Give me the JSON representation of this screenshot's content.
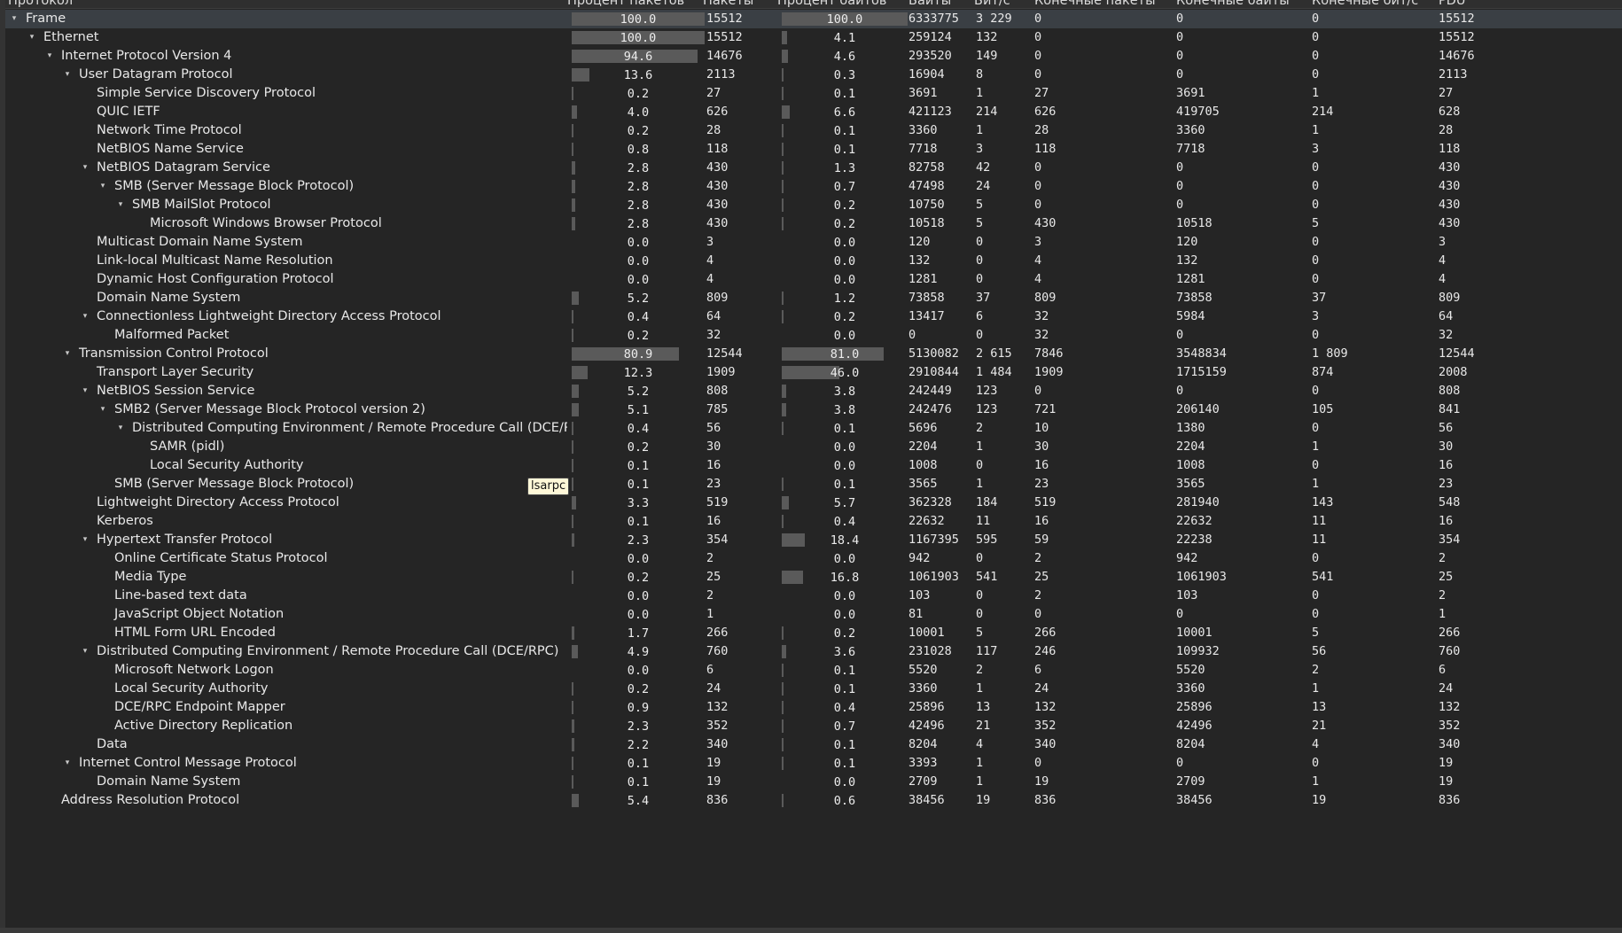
{
  "columns": [
    "Протокол",
    "Процент пакетов",
    "Пакеты",
    "Процент байтов",
    "Байты",
    "Бит/с",
    "Конечные пакеты",
    "Конечные байты",
    "Конечные бит/с",
    "PDU"
  ],
  "tooltip": "lsarpc",
  "rows": [
    {
      "name": "Frame",
      "level": 0,
      "toggle": "▾",
      "pkt_pct": "100.0",
      "packets": "15512",
      "byte_pct": "100.0",
      "bytes": "6333775",
      "bps": "3 229",
      "end_packets": "0",
      "end_bytes": "0",
      "end_bps": "0",
      "pdu": "15512",
      "pkt_pct_value": 100.0,
      "byte_pct_value": 100.0
    },
    {
      "name": "Ethernet",
      "level": 1,
      "toggle": "▾",
      "pkt_pct": "100.0",
      "packets": "15512",
      "byte_pct": "4.1",
      "bytes": "259124",
      "bps": "132",
      "end_packets": "0",
      "end_bytes": "0",
      "end_bps": "0",
      "pdu": "15512",
      "pkt_pct_value": 100.0,
      "byte_pct_value": 4.1
    },
    {
      "name": "Internet Protocol Version 4",
      "level": 2,
      "toggle": "▾",
      "pkt_pct": "94.6",
      "packets": "14676",
      "byte_pct": "4.6",
      "bytes": "293520",
      "bps": "149",
      "end_packets": "0",
      "end_bytes": "0",
      "end_bps": "0",
      "pdu": "14676",
      "pkt_pct_value": 94.6,
      "byte_pct_value": 4.6
    },
    {
      "name": "User Datagram Protocol",
      "level": 3,
      "toggle": "▾",
      "pkt_pct": "13.6",
      "packets": "2113",
      "byte_pct": "0.3",
      "bytes": "16904",
      "bps": "8",
      "end_packets": "0",
      "end_bytes": "0",
      "end_bps": "0",
      "pdu": "2113",
      "pkt_pct_value": 13.6,
      "byte_pct_value": 0.3
    },
    {
      "name": "Simple Service Discovery Protocol",
      "level": 4,
      "toggle": "",
      "pkt_pct": "0.2",
      "packets": "27",
      "byte_pct": "0.1",
      "bytes": "3691",
      "bps": "1",
      "end_packets": "27",
      "end_bytes": "3691",
      "end_bps": "1",
      "pdu": "27",
      "pkt_pct_value": 0.2,
      "byte_pct_value": 0.1
    },
    {
      "name": "QUIC IETF",
      "level": 4,
      "toggle": "",
      "pkt_pct": "4.0",
      "packets": "626",
      "byte_pct": "6.6",
      "bytes": "421123",
      "bps": "214",
      "end_packets": "626",
      "end_bytes": "419705",
      "end_bps": "214",
      "pdu": "628",
      "pkt_pct_value": 4.0,
      "byte_pct_value": 6.6
    },
    {
      "name": "Network Time Protocol",
      "level": 4,
      "toggle": "",
      "pkt_pct": "0.2",
      "packets": "28",
      "byte_pct": "0.1",
      "bytes": "3360",
      "bps": "1",
      "end_packets": "28",
      "end_bytes": "3360",
      "end_bps": "1",
      "pdu": "28",
      "pkt_pct_value": 0.2,
      "byte_pct_value": 0.1
    },
    {
      "name": "NetBIOS Name Service",
      "level": 4,
      "toggle": "",
      "pkt_pct": "0.8",
      "packets": "118",
      "byte_pct": "0.1",
      "bytes": "7718",
      "bps": "3",
      "end_packets": "118",
      "end_bytes": "7718",
      "end_bps": "3",
      "pdu": "118",
      "pkt_pct_value": 0.8,
      "byte_pct_value": 0.1
    },
    {
      "name": "NetBIOS Datagram Service",
      "level": 4,
      "toggle": "▾",
      "pkt_pct": "2.8",
      "packets": "430",
      "byte_pct": "1.3",
      "bytes": "82758",
      "bps": "42",
      "end_packets": "0",
      "end_bytes": "0",
      "end_bps": "0",
      "pdu": "430",
      "pkt_pct_value": 2.8,
      "byte_pct_value": 1.3
    },
    {
      "name": "SMB (Server Message Block Protocol)",
      "level": 5,
      "toggle": "▾",
      "pkt_pct": "2.8",
      "packets": "430",
      "byte_pct": "0.7",
      "bytes": "47498",
      "bps": "24",
      "end_packets": "0",
      "end_bytes": "0",
      "end_bps": "0",
      "pdu": "430",
      "pkt_pct_value": 2.8,
      "byte_pct_value": 0.7
    },
    {
      "name": "SMB MailSlot Protocol",
      "level": 6,
      "toggle": "▾",
      "pkt_pct": "2.8",
      "packets": "430",
      "byte_pct": "0.2",
      "bytes": "10750",
      "bps": "5",
      "end_packets": "0",
      "end_bytes": "0",
      "end_bps": "0",
      "pdu": "430",
      "pkt_pct_value": 2.8,
      "byte_pct_value": 0.2
    },
    {
      "name": "Microsoft Windows Browser Protocol",
      "level": 7,
      "toggle": "",
      "pkt_pct": "2.8",
      "packets": "430",
      "byte_pct": "0.2",
      "bytes": "10518",
      "bps": "5",
      "end_packets": "430",
      "end_bytes": "10518",
      "end_bps": "5",
      "pdu": "430",
      "pkt_pct_value": 2.8,
      "byte_pct_value": 0.2
    },
    {
      "name": "Multicast Domain Name System",
      "level": 4,
      "toggle": "",
      "pkt_pct": "0.0",
      "packets": "3",
      "byte_pct": "0.0",
      "bytes": "120",
      "bps": "0",
      "end_packets": "3",
      "end_bytes": "120",
      "end_bps": "0",
      "pdu": "3",
      "pkt_pct_value": 0.0,
      "byte_pct_value": 0.0
    },
    {
      "name": "Link-local Multicast Name Resolution",
      "level": 4,
      "toggle": "",
      "pkt_pct": "0.0",
      "packets": "4",
      "byte_pct": "0.0",
      "bytes": "132",
      "bps": "0",
      "end_packets": "4",
      "end_bytes": "132",
      "end_bps": "0",
      "pdu": "4",
      "pkt_pct_value": 0.0,
      "byte_pct_value": 0.0
    },
    {
      "name": "Dynamic Host Configuration Protocol",
      "level": 4,
      "toggle": "",
      "pkt_pct": "0.0",
      "packets": "4",
      "byte_pct": "0.0",
      "bytes": "1281",
      "bps": "0",
      "end_packets": "4",
      "end_bytes": "1281",
      "end_bps": "0",
      "pdu": "4",
      "pkt_pct_value": 0.0,
      "byte_pct_value": 0.0
    },
    {
      "name": "Domain Name System",
      "level": 4,
      "toggle": "",
      "pkt_pct": "5.2",
      "packets": "809",
      "byte_pct": "1.2",
      "bytes": "73858",
      "bps": "37",
      "end_packets": "809",
      "end_bytes": "73858",
      "end_bps": "37",
      "pdu": "809",
      "pkt_pct_value": 5.2,
      "byte_pct_value": 1.2
    },
    {
      "name": "Connectionless Lightweight Directory Access Protocol",
      "level": 4,
      "toggle": "▾",
      "pkt_pct": "0.4",
      "packets": "64",
      "byte_pct": "0.2",
      "bytes": "13417",
      "bps": "6",
      "end_packets": "32",
      "end_bytes": "5984",
      "end_bps": "3",
      "pdu": "64",
      "pkt_pct_value": 0.4,
      "byte_pct_value": 0.2
    },
    {
      "name": "Malformed Packet",
      "level": 5,
      "toggle": "",
      "pkt_pct": "0.2",
      "packets": "32",
      "byte_pct": "0.0",
      "bytes": "0",
      "bps": "0",
      "end_packets": "32",
      "end_bytes": "0",
      "end_bps": "0",
      "pdu": "32",
      "pkt_pct_value": 0.2,
      "byte_pct_value": 0.0
    },
    {
      "name": "Transmission Control Protocol",
      "level": 3,
      "toggle": "▾",
      "pkt_pct": "80.9",
      "packets": "12544",
      "byte_pct": "81.0",
      "bytes": "5130082",
      "bps": "2 615",
      "end_packets": "7846",
      "end_bytes": "3548834",
      "end_bps": "1 809",
      "pdu": "12544",
      "pkt_pct_value": 80.9,
      "byte_pct_value": 81.0
    },
    {
      "name": "Transport Layer Security",
      "level": 4,
      "toggle": "",
      "pkt_pct": "12.3",
      "packets": "1909",
      "byte_pct": "46.0",
      "bytes": "2910844",
      "bps": "1 484",
      "end_packets": "1909",
      "end_bytes": "1715159",
      "end_bps": "874",
      "pdu": "2008",
      "pkt_pct_value": 12.3,
      "byte_pct_value": 46.0
    },
    {
      "name": "NetBIOS Session Service",
      "level": 4,
      "toggle": "▾",
      "pkt_pct": "5.2",
      "packets": "808",
      "byte_pct": "3.8",
      "bytes": "242449",
      "bps": "123",
      "end_packets": "0",
      "end_bytes": "0",
      "end_bps": "0",
      "pdu": "808",
      "pkt_pct_value": 5.2,
      "byte_pct_value": 3.8
    },
    {
      "name": "SMB2 (Server Message Block Protocol version 2)",
      "level": 5,
      "toggle": "▾",
      "pkt_pct": "5.1",
      "packets": "785",
      "byte_pct": "3.8",
      "bytes": "242476",
      "bps": "123",
      "end_packets": "721",
      "end_bytes": "206140",
      "end_bps": "105",
      "pdu": "841",
      "pkt_pct_value": 5.1,
      "byte_pct_value": 3.8
    },
    {
      "name": "Distributed Computing Environment / Remote Procedure Call (DCE/RPC)",
      "level": 6,
      "toggle": "▾",
      "pkt_pct": "0.4",
      "packets": "56",
      "byte_pct": "0.1",
      "bytes": "5696",
      "bps": "2",
      "end_packets": "10",
      "end_bytes": "1380",
      "end_bps": "0",
      "pdu": "56",
      "pkt_pct_value": 0.4,
      "byte_pct_value": 0.1
    },
    {
      "name": "SAMR (pidl)",
      "level": 7,
      "toggle": "",
      "pkt_pct": "0.2",
      "packets": "30",
      "byte_pct": "0.0",
      "bytes": "2204",
      "bps": "1",
      "end_packets": "30",
      "end_bytes": "2204",
      "end_bps": "1",
      "pdu": "30",
      "pkt_pct_value": 0.2,
      "byte_pct_value": 0.0
    },
    {
      "name": "Local Security Authority",
      "level": 7,
      "toggle": "",
      "pkt_pct": "0.1",
      "packets": "16",
      "byte_pct": "0.0",
      "bytes": "1008",
      "bps": "0",
      "end_packets": "16",
      "end_bytes": "1008",
      "end_bps": "0",
      "pdu": "16",
      "pkt_pct_value": 0.1,
      "byte_pct_value": 0.0
    },
    {
      "name": "SMB (Server Message Block Protocol)",
      "level": 5,
      "toggle": "",
      "pkt_pct": "0.1",
      "packets": "23",
      "byte_pct": "0.1",
      "bytes": "3565",
      "bps": "1",
      "end_packets": "23",
      "end_bytes": "3565",
      "end_bps": "1",
      "pdu": "23",
      "pkt_pct_value": 0.1,
      "byte_pct_value": 0.1
    },
    {
      "name": "Lightweight Directory Access Protocol",
      "level": 4,
      "toggle": "",
      "pkt_pct": "3.3",
      "packets": "519",
      "byte_pct": "5.7",
      "bytes": "362328",
      "bps": "184",
      "end_packets": "519",
      "end_bytes": "281940",
      "end_bps": "143",
      "pdu": "548",
      "pkt_pct_value": 3.3,
      "byte_pct_value": 5.7
    },
    {
      "name": "Kerberos",
      "level": 4,
      "toggle": "",
      "pkt_pct": "0.1",
      "packets": "16",
      "byte_pct": "0.4",
      "bytes": "22632",
      "bps": "11",
      "end_packets": "16",
      "end_bytes": "22632",
      "end_bps": "11",
      "pdu": "16",
      "pkt_pct_value": 0.1,
      "byte_pct_value": 0.4
    },
    {
      "name": "Hypertext Transfer Protocol",
      "level": 4,
      "toggle": "▾",
      "pkt_pct": "2.3",
      "packets": "354",
      "byte_pct": "18.4",
      "bytes": "1167395",
      "bps": "595",
      "end_packets": "59",
      "end_bytes": "22238",
      "end_bps": "11",
      "pdu": "354",
      "pkt_pct_value": 2.3,
      "byte_pct_value": 18.4
    },
    {
      "name": "Online Certificate Status Protocol",
      "level": 5,
      "toggle": "",
      "pkt_pct": "0.0",
      "packets": "2",
      "byte_pct": "0.0",
      "bytes": "942",
      "bps": "0",
      "end_packets": "2",
      "end_bytes": "942",
      "end_bps": "0",
      "pdu": "2",
      "pkt_pct_value": 0.0,
      "byte_pct_value": 0.0
    },
    {
      "name": "Media Type",
      "level": 5,
      "toggle": "",
      "pkt_pct": "0.2",
      "packets": "25",
      "byte_pct": "16.8",
      "bytes": "1061903",
      "bps": "541",
      "end_packets": "25",
      "end_bytes": "1061903",
      "end_bps": "541",
      "pdu": "25",
      "pkt_pct_value": 0.2,
      "byte_pct_value": 16.8
    },
    {
      "name": "Line-based text data",
      "level": 5,
      "toggle": "",
      "pkt_pct": "0.0",
      "packets": "2",
      "byte_pct": "0.0",
      "bytes": "103",
      "bps": "0",
      "end_packets": "2",
      "end_bytes": "103",
      "end_bps": "0",
      "pdu": "2",
      "pkt_pct_value": 0.0,
      "byte_pct_value": 0.0
    },
    {
      "name": "JavaScript Object Notation",
      "level": 5,
      "toggle": "",
      "pkt_pct": "0.0",
      "packets": "1",
      "byte_pct": "0.0",
      "bytes": "81",
      "bps": "0",
      "end_packets": "0",
      "end_bytes": "0",
      "end_bps": "0",
      "pdu": "1",
      "pkt_pct_value": 0.0,
      "byte_pct_value": 0.0
    },
    {
      "name": "HTML Form URL Encoded",
      "level": 5,
      "toggle": "",
      "pkt_pct": "1.7",
      "packets": "266",
      "byte_pct": "0.2",
      "bytes": "10001",
      "bps": "5",
      "end_packets": "266",
      "end_bytes": "10001",
      "end_bps": "5",
      "pdu": "266",
      "pkt_pct_value": 1.7,
      "byte_pct_value": 0.2
    },
    {
      "name": "Distributed Computing Environment / Remote Procedure Call (DCE/RPC)",
      "level": 4,
      "toggle": "▾",
      "pkt_pct": "4.9",
      "packets": "760",
      "byte_pct": "3.6",
      "bytes": "231028",
      "bps": "117",
      "end_packets": "246",
      "end_bytes": "109932",
      "end_bps": "56",
      "pdu": "760",
      "pkt_pct_value": 4.9,
      "byte_pct_value": 3.6
    },
    {
      "name": "Microsoft Network Logon",
      "level": 5,
      "toggle": "",
      "pkt_pct": "0.0",
      "packets": "6",
      "byte_pct": "0.1",
      "bytes": "5520",
      "bps": "2",
      "end_packets": "6",
      "end_bytes": "5520",
      "end_bps": "2",
      "pdu": "6",
      "pkt_pct_value": 0.0,
      "byte_pct_value": 0.1
    },
    {
      "name": "Local Security Authority",
      "level": 5,
      "toggle": "",
      "pkt_pct": "0.2",
      "packets": "24",
      "byte_pct": "0.1",
      "bytes": "3360",
      "bps": "1",
      "end_packets": "24",
      "end_bytes": "3360",
      "end_bps": "1",
      "pdu": "24",
      "pkt_pct_value": 0.2,
      "byte_pct_value": 0.1
    },
    {
      "name": "DCE/RPC Endpoint Mapper",
      "level": 5,
      "toggle": "",
      "pkt_pct": "0.9",
      "packets": "132",
      "byte_pct": "0.4",
      "bytes": "25896",
      "bps": "13",
      "end_packets": "132",
      "end_bytes": "25896",
      "end_bps": "13",
      "pdu": "132",
      "pkt_pct_value": 0.9,
      "byte_pct_value": 0.4
    },
    {
      "name": "Active Directory Replication",
      "level": 5,
      "toggle": "",
      "pkt_pct": "2.3",
      "packets": "352",
      "byte_pct": "0.7",
      "bytes": "42496",
      "bps": "21",
      "end_packets": "352",
      "end_bytes": "42496",
      "end_bps": "21",
      "pdu": "352",
      "pkt_pct_value": 2.3,
      "byte_pct_value": 0.7
    },
    {
      "name": "Data",
      "level": 4,
      "toggle": "",
      "pkt_pct": "2.2",
      "packets": "340",
      "byte_pct": "0.1",
      "bytes": "8204",
      "bps": "4",
      "end_packets": "340",
      "end_bytes": "8204",
      "end_bps": "4",
      "pdu": "340",
      "pkt_pct_value": 2.2,
      "byte_pct_value": 0.1
    },
    {
      "name": "Internet Control Message Protocol",
      "level": 3,
      "toggle": "▾",
      "pkt_pct": "0.1",
      "packets": "19",
      "byte_pct": "0.1",
      "bytes": "3393",
      "bps": "1",
      "end_packets": "0",
      "end_bytes": "0",
      "end_bps": "0",
      "pdu": "19",
      "pkt_pct_value": 0.1,
      "byte_pct_value": 0.1
    },
    {
      "name": "Domain Name System",
      "level": 4,
      "toggle": "",
      "pkt_pct": "0.1",
      "packets": "19",
      "byte_pct": "0.0",
      "bytes": "2709",
      "bps": "1",
      "end_packets": "19",
      "end_bytes": "2709",
      "end_bps": "1",
      "pdu": "19",
      "pkt_pct_value": 0.1,
      "byte_pct_value": 0.0
    },
    {
      "name": "Address Resolution Protocol",
      "level": 2,
      "toggle": "",
      "pkt_pct": "5.4",
      "packets": "836",
      "byte_pct": "0.6",
      "bytes": "38456",
      "bps": "19",
      "end_packets": "836",
      "end_bytes": "38456",
      "end_bps": "19",
      "pdu": "836",
      "pkt_pct_value": 5.4,
      "byte_pct_value": 0.6
    }
  ]
}
